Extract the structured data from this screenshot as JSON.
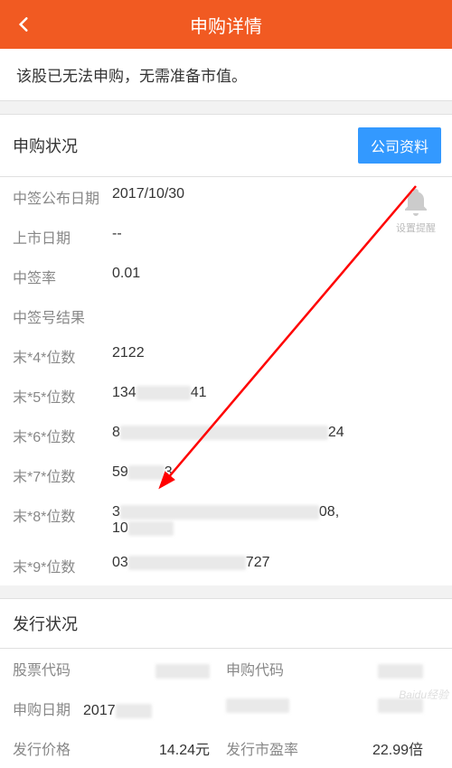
{
  "header": {
    "title": "申购详情"
  },
  "notice": "该股已无法申购，无需准备市值。",
  "subscription": {
    "section_title": "申购状况",
    "company_btn": "公司资料",
    "reminder_label": "设置提醒",
    "rows": {
      "announce_date_label": "中签公布日期",
      "announce_date_value": "2017/10/30",
      "listing_date_label": "上市日期",
      "listing_date_value": "--",
      "lottery_rate_label": "中签率",
      "lottery_rate_value": "0.01",
      "lottery_result_label": "中签号结果",
      "tail4_label": "末*4*位数",
      "tail4_value": "2122",
      "tail5_label": "末*5*位数",
      "tail5_value_a": "134",
      "tail5_value_b": "41",
      "tail6_label": "末*6*位数",
      "tail6_value_a": "8",
      "tail6_value_b": "24",
      "tail7_label": "末*7*位数",
      "tail7_value_a": "59",
      "tail7_value_b": "3",
      "tail8_label": "末*8*位数",
      "tail8_value_a": "3",
      "tail8_value_b": "08,",
      "tail8_value_c": "10",
      "tail9_label": "末*9*位数",
      "tail9_value_a": "03",
      "tail9_value_b": "727"
    }
  },
  "issue": {
    "section_title": "发行状况",
    "rows": {
      "stock_code_label": "股票代码",
      "subscribe_code_label": "申购代码",
      "subscribe_date_label": "申购日期",
      "subscribe_date_value": "2017",
      "issue_price_label": "发行价格",
      "issue_price_value": "14.24元",
      "pe_ratio_label": "发行市盈率",
      "pe_ratio_value": "22.99倍"
    }
  },
  "watermark": "Baidu经验"
}
